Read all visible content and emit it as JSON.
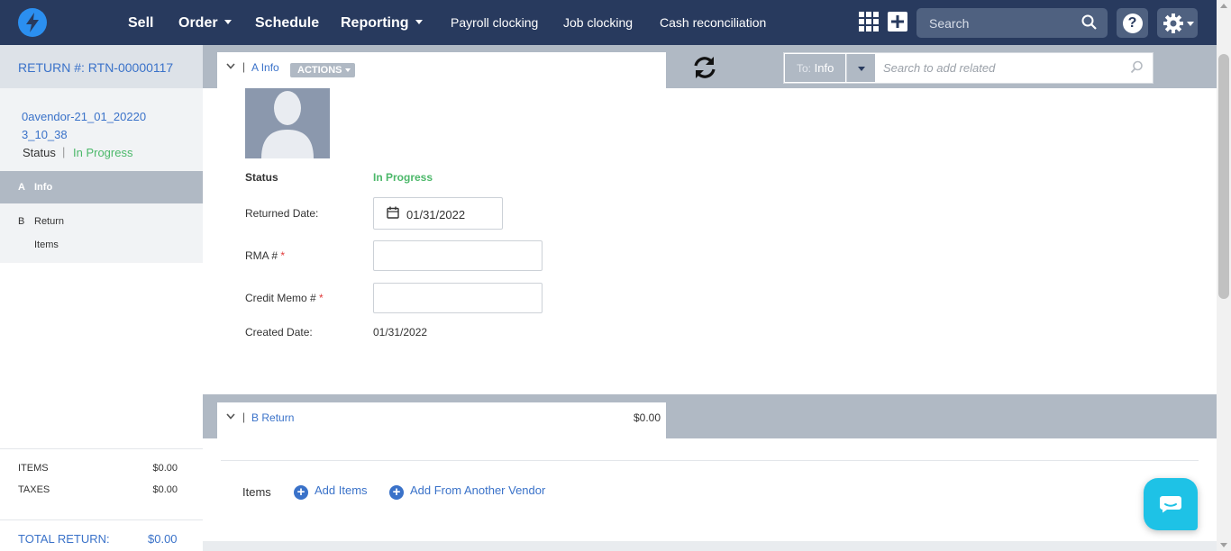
{
  "nav": {
    "items": [
      {
        "label": "Sell",
        "dropdown": false
      },
      {
        "label": "Order",
        "dropdown": true
      },
      {
        "label": "Schedule",
        "dropdown": false
      },
      {
        "label": "Reporting",
        "dropdown": true
      }
    ],
    "links": [
      "Payroll clocking",
      "Job clocking",
      "Cash reconciliation"
    ],
    "search_placeholder": "Search",
    "help_label": "?"
  },
  "sidebar": {
    "return_number": "RETURN #: RTN-00000117",
    "vendor": "0avendor-21_01_20220 3_10_38",
    "status_label": "Status",
    "status_sep": "|",
    "status_value": "In Progress",
    "sections": [
      {
        "letter": "A",
        "label": "Info",
        "sub": ""
      },
      {
        "letter": "B",
        "label": "Return",
        "sub": "Items"
      }
    ],
    "totals": {
      "items_label": "ITEMS",
      "items_value": "$0.00",
      "taxes_label": "TAXES",
      "taxes_value": "$0.00",
      "total_label": "TOTAL RETURN:",
      "total_value": "$0.00"
    }
  },
  "section_a": {
    "letter": "A",
    "title": "Info",
    "actions_label": "ACTIONS",
    "vendor_title": "0avendor-21_01_202203_10_38"
  },
  "related": {
    "to_prefix": "To:",
    "to_value": "Info",
    "placeholder": "Search to add related"
  },
  "form": {
    "status_label": "Status",
    "status_value": "In Progress",
    "returned_date_label": "Returned Date:",
    "returned_date_value": "01/31/2022",
    "rma_label": "RMA #",
    "credit_memo_label": "Credit Memo #",
    "required_mark": "*",
    "created_date_label": "Created Date:",
    "created_date_value": "01/31/2022"
  },
  "section_b": {
    "letter": "B",
    "title": "Return",
    "amount": "$0.00",
    "items_label": "Items",
    "add_items_label": "Add Items",
    "add_from_vendor_label": "Add From Another Vendor"
  },
  "colors": {
    "nav_bg": "#283a5e",
    "accent": "#3a72c9",
    "status_green": "#4cb86a",
    "band_gray": "#b0b9c4",
    "chat": "#1ec2e6"
  }
}
